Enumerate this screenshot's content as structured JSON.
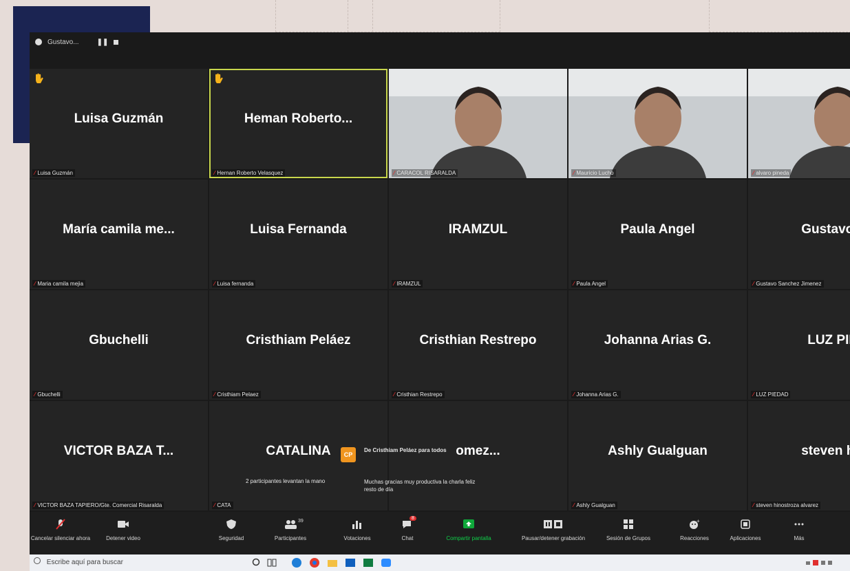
{
  "window": {
    "title": "Gustavo..."
  },
  "tiles": [
    {
      "name": "Luisa Guzmán",
      "sub": "Luisa Guzmán",
      "hand": true
    },
    {
      "name": "Heman Roberto...",
      "sub": "Hernan Roberto Velasquez",
      "hand": true,
      "active": true
    },
    {
      "name": "",
      "sub": "CARACOL RISARALDA",
      "video": true
    },
    {
      "name": "",
      "sub": "Mauricio Lucho",
      "video": true
    },
    {
      "name": "",
      "sub": "alvaro pineda",
      "video": true
    },
    {
      "name": "María camila me...",
      "sub": "Maria camila mejia"
    },
    {
      "name": "Luisa Fernanda",
      "sub": "Luisa fernanda"
    },
    {
      "name": "IRAMZUL",
      "sub": "IRAMZUL"
    },
    {
      "name": "Paula Angel",
      "sub": "Paula Angel"
    },
    {
      "name": "Gustavo Sa",
      "sub": "Gustavo Sanchez Jimenez"
    },
    {
      "name": "Gbuchelli",
      "sub": "Gbuchelli"
    },
    {
      "name": "Cristhiam Peláez",
      "sub": "Cristhiam Pelaez"
    },
    {
      "name": "Cristhian Restrepo",
      "sub": "Cristhian Restrepo"
    },
    {
      "name": "Johanna Arias G.",
      "sub": "Johanna Arias G."
    },
    {
      "name": "LUZ PIED",
      "sub": "LUZ PIEDAD"
    },
    {
      "name": "VICTOR BAZA T...",
      "sub": "VICTOR BAZA TAPIERO/Gte. Comercial Risaralda"
    },
    {
      "name": "CATALINA",
      "sub": "CATA"
    },
    {
      "name": "omez...",
      "sub": ""
    },
    {
      "name": "Ashly Gualguan",
      "sub": "Ashly Gualguan"
    },
    {
      "name": "steven hinc",
      "sub": "steven hinostroza alvarez"
    }
  ],
  "notifications": {
    "hands": "2 participantes levantan la mano",
    "chat_badge": "CP",
    "chat_from": "De Cristhiam Peláez para todos",
    "chat_message": "Muchas gracias muy productiva la charla feliz resto de día"
  },
  "toolbar": {
    "items": [
      {
        "label": "Cancelar silenciar ahora",
        "icon": "microphone-muted-icon"
      },
      {
        "label": "Detener video",
        "icon": "video-camera-icon"
      },
      {
        "label": "Seguridad",
        "icon": "shield-icon"
      },
      {
        "label": "Participantes",
        "icon": "participants-icon"
      },
      {
        "label": "Votaciones",
        "icon": "poll-icon"
      },
      {
        "label": "Chat",
        "icon": "chat-icon"
      },
      {
        "label": "Compartir pantalla",
        "icon": "share-screen-icon"
      },
      {
        "label": "Pausar/detener grabación",
        "icon": "recording-icon"
      },
      {
        "label": "Sesión de Grupos",
        "icon": "breakout-rooms-icon"
      },
      {
        "label": "Reacciones",
        "icon": "reactions-icon"
      },
      {
        "label": "Aplicaciones",
        "icon": "apps-icon"
      },
      {
        "label": "Más",
        "icon": "more-icon"
      }
    ],
    "participants_count": "39",
    "chat_badge": "8"
  },
  "taskbar": {
    "search_placeholder": "Escribe aquí para buscar"
  },
  "colors": {
    "active_border": "#c9d74c",
    "share_green": "#0fa83a",
    "navy": "#1b2452",
    "record_red": "#e02f2f"
  }
}
